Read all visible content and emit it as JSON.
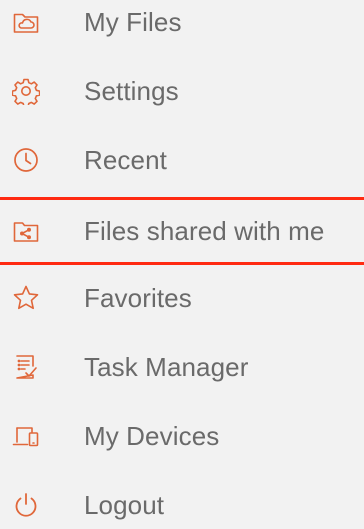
{
  "menu": {
    "accent_color": "#e0673a",
    "highlight_color": "#ff2a12",
    "text_color": "#6a6a6a",
    "items": [
      {
        "label": "My Files",
        "icon": "folder-cloud-icon"
      },
      {
        "label": "Settings",
        "icon": "gear-icon"
      },
      {
        "label": "Recent",
        "icon": "clock-icon"
      },
      {
        "label": "Files shared with me",
        "icon": "shared-folder-icon",
        "highlighted": true
      },
      {
        "label": "Favorites",
        "icon": "star-icon"
      },
      {
        "label": "Task Manager",
        "icon": "task-list-icon"
      },
      {
        "label": "My Devices",
        "icon": "devices-icon"
      },
      {
        "label": "Logout",
        "icon": "power-icon"
      }
    ]
  }
}
